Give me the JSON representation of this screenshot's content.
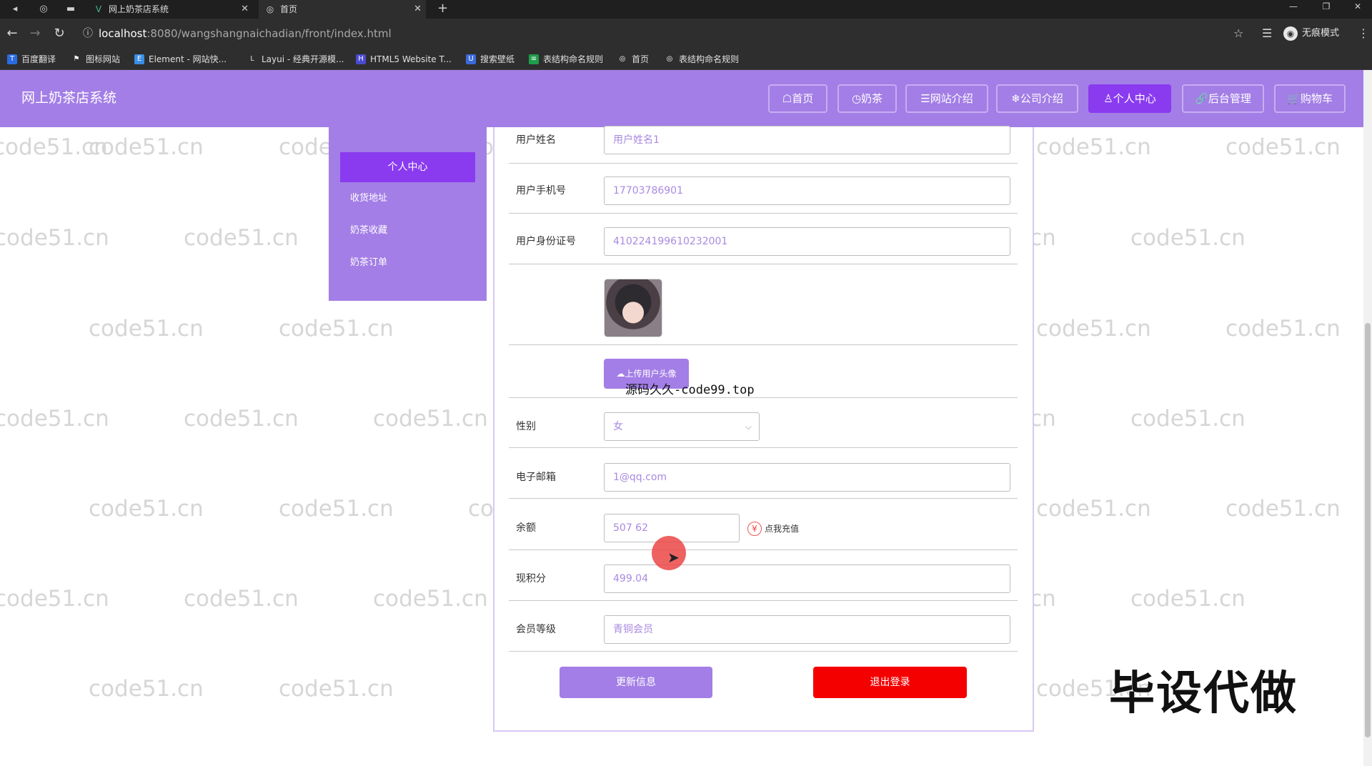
{
  "browser": {
    "tabs": [
      {
        "title": "网上奶茶店系统",
        "active": false
      },
      {
        "title": "首页",
        "active": true
      }
    ],
    "url_host": "localhost",
    "url_path": ":8080/wangshangnaichadian/front/index.html",
    "incognito_label": "无痕模式",
    "bookmarks": [
      "百度翻译",
      "图标网站",
      "Element - 网站快...",
      "Layui - 经典开源模...",
      "HTML5 Website T...",
      "搜索壁纸",
      "表结构命名规则",
      "首页",
      "表结构命名规则"
    ]
  },
  "header": {
    "site_title": "网上奶茶店系统",
    "nav": [
      {
        "label": "☖首页",
        "active": false
      },
      {
        "label": "◷奶茶",
        "active": false
      },
      {
        "label": "☰网站介绍",
        "active": false
      },
      {
        "label": "❄公司介绍",
        "active": false
      },
      {
        "label": "♙个人中心",
        "active": true
      },
      {
        "label": "🔗后台管理",
        "active": false
      },
      {
        "label": "🛒购物车",
        "active": false
      }
    ]
  },
  "sidebar": {
    "active": "个人中心",
    "items": [
      "收货地址",
      "奶茶收藏",
      "奶茶订单"
    ]
  },
  "form": {
    "username": {
      "label": "用户姓名",
      "value": "用户姓名1"
    },
    "phone": {
      "label": "用户手机号",
      "value": "17703786901"
    },
    "idcard": {
      "label": "用户身份证号",
      "value": "410224199610232001"
    },
    "upload_label": "上传用户头像",
    "gender": {
      "label": "性别",
      "value": "女"
    },
    "email": {
      "label": "电子邮箱",
      "value": "1@qq.com"
    },
    "balance": {
      "label": "余额",
      "value": "507 62",
      "recharge": "点我充值"
    },
    "points": {
      "label": "现积分",
      "value": "499.04"
    },
    "level": {
      "label": "会员等级",
      "value": "青铜会员"
    },
    "update_button": "更新信息",
    "logout_button": "退出登录"
  },
  "overlays": {
    "watermark_text": "code51.cn",
    "source_note": "源码久久-code99.top",
    "stamp": "毕设代做"
  },
  "colors": {
    "header": "#a37ee6",
    "active": "#8a3bf0",
    "logout": "#f40000"
  }
}
